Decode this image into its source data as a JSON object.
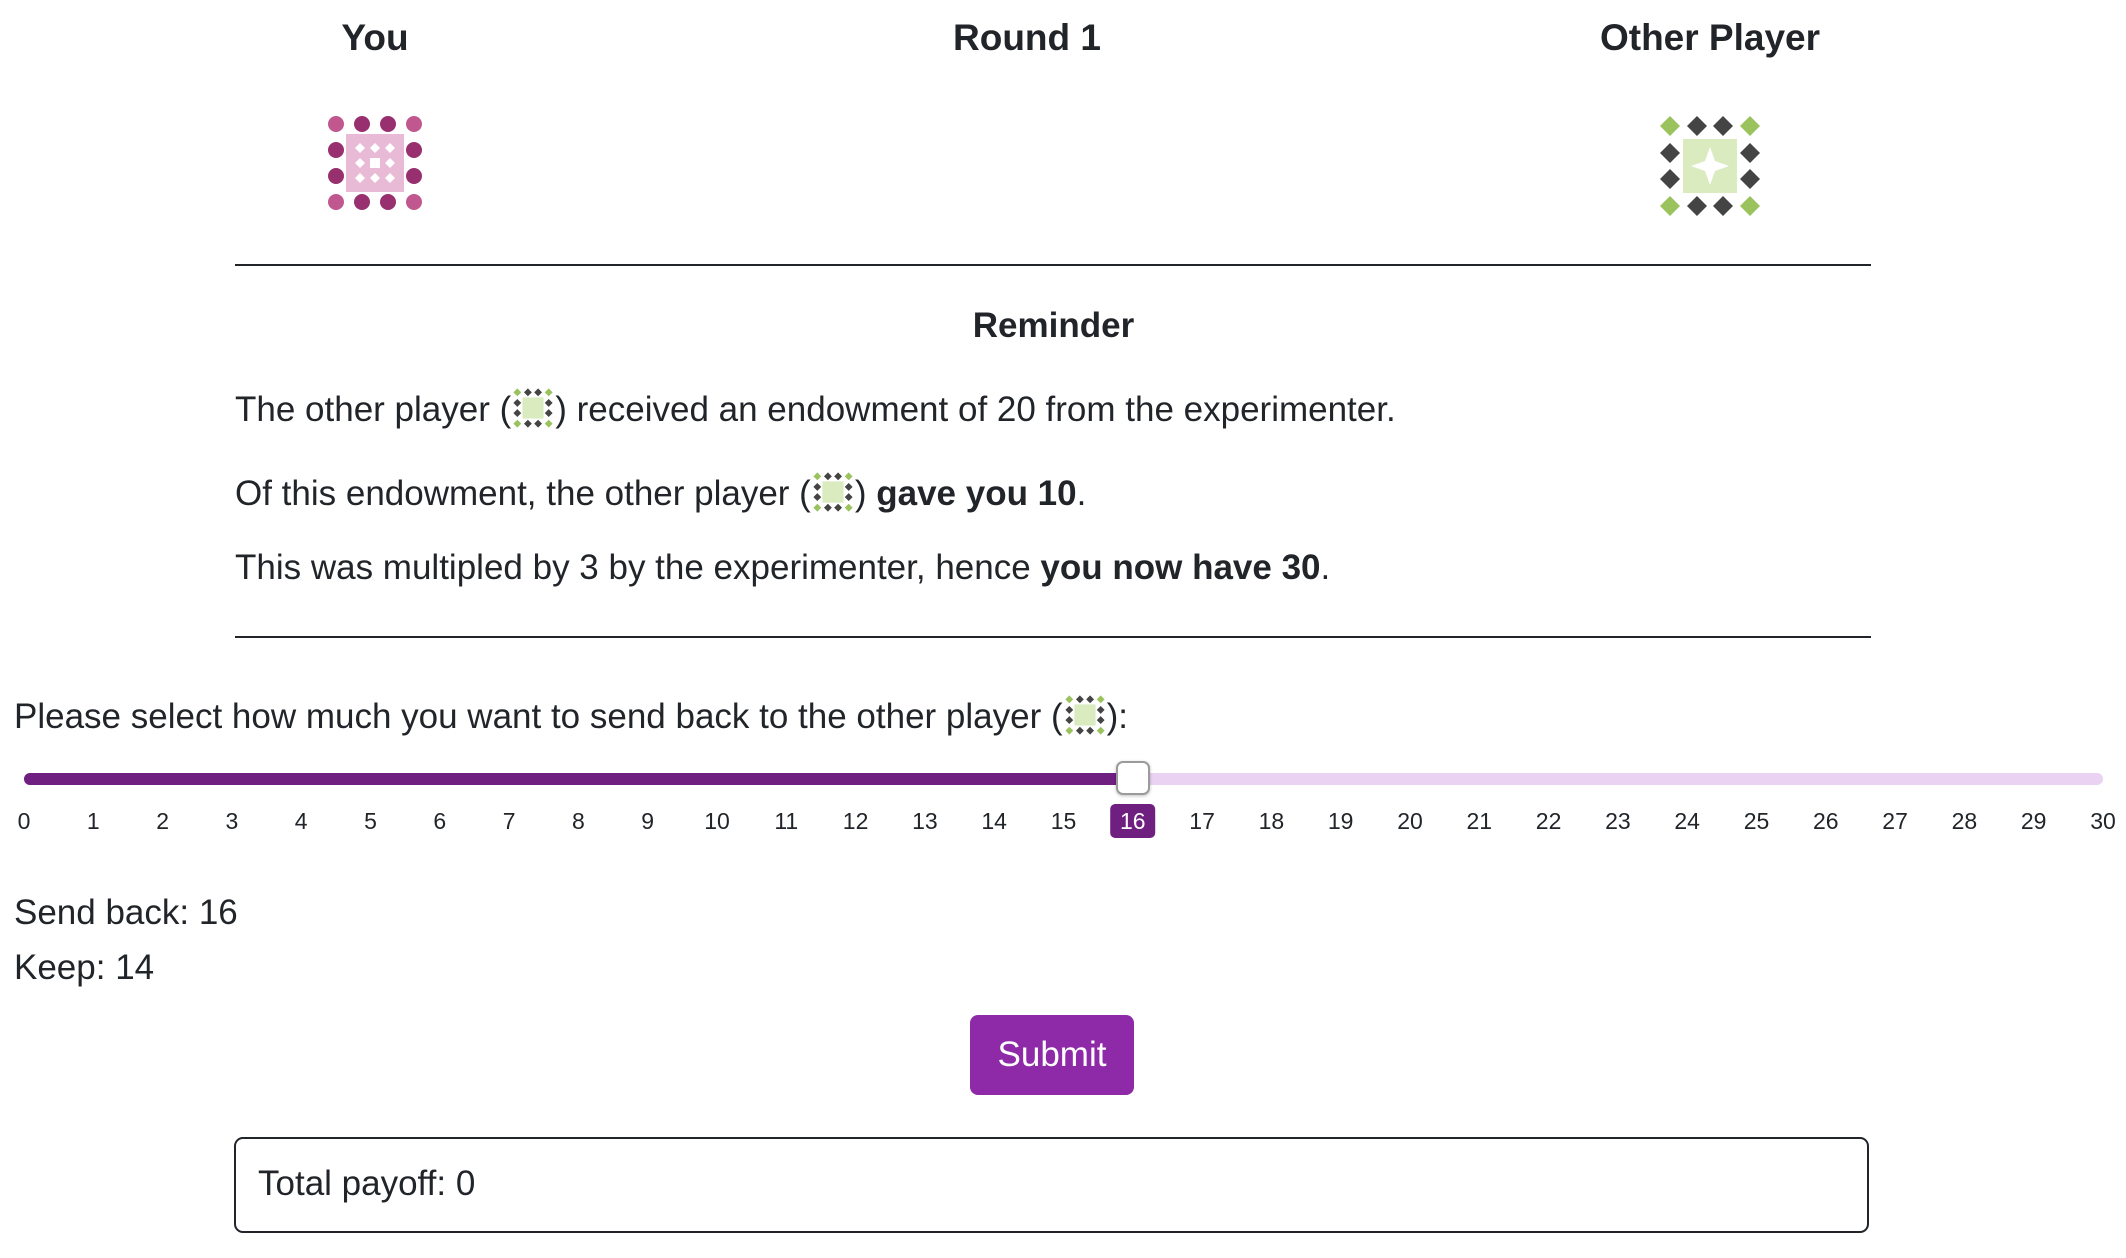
{
  "header": {
    "you_label": "You",
    "round_label": "Round 1",
    "other_label": "Other Player"
  },
  "reminder": {
    "title": "Reminder",
    "line1": {
      "pre": "The other player (",
      "post": ") received an endowment of 20 from the experimenter."
    },
    "line2": {
      "pre": "Of this endowment, the other player (",
      "mid": ") ",
      "bold": "gave you 10",
      "post": "."
    },
    "line3": {
      "pre": "This was multipled by 3 by the experimenter, hence ",
      "bold": "you now have 30",
      "post": "."
    }
  },
  "prompt": {
    "pre": "Please select how much you want to send back to the other player (",
    "post": "):"
  },
  "slider": {
    "min": 0,
    "max": 30,
    "value": 16
  },
  "status": {
    "send_back": "Send back: 16",
    "keep": "Keep: 14"
  },
  "submit_label": "Submit",
  "payoff": "Total payoff: 0",
  "colors": {
    "accent": "#6f1f80",
    "button": "#8e2aa8",
    "track": "#ead3f2",
    "you_icon": [
      "#c0588f",
      "#983070",
      "#e9bad6"
    ],
    "other_icon": [
      "#9ac35d",
      "#444444",
      "#d9ebbf"
    ]
  },
  "icons": {
    "you": "pink-dot-quilt-icon",
    "other": "green-diamond-quilt-icon"
  }
}
